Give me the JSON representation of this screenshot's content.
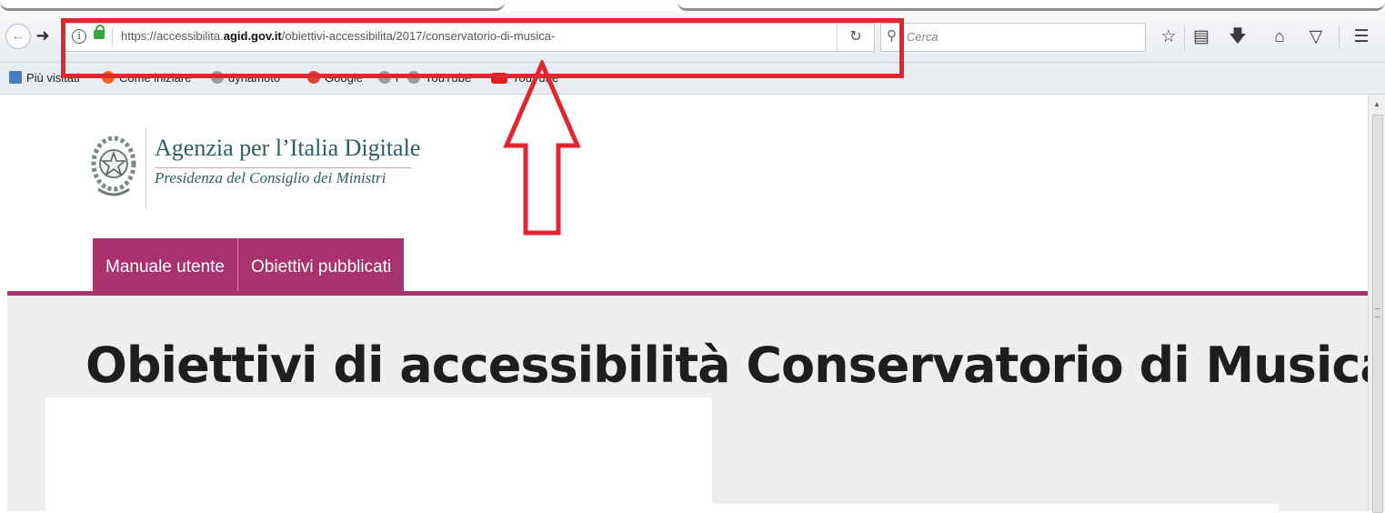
{
  "browser": {
    "url": {
      "prefix": "https://accessibilita.",
      "host": "agid.gov.it",
      "path": "/obiettivi-accessibilita/2017/conservatorio-di-musica-"
    },
    "search_placeholder": "Cerca",
    "bookmarks": [
      {
        "label": "Più visitati",
        "icon": "bookmark-folder-icon"
      },
      {
        "label": "Come iniziare",
        "icon": "firefox-icon"
      },
      {
        "label": "dynamoto",
        "icon": "globe-icon"
      },
      {
        "label": "Google",
        "icon": "google-icon"
      },
      {
        "label": "i",
        "icon": "globe-icon"
      },
      {
        "label": "YouTube",
        "icon": "globe-icon"
      },
      {
        "label": "YouTube",
        "icon": "youtube-icon"
      }
    ],
    "toolbar_icons": [
      "bookmark-star-icon",
      "reading-list-icon",
      "download-icon",
      "home-icon",
      "pocket-icon",
      "menu-icon"
    ]
  },
  "site": {
    "org_name": "Agenzia per l’Italia Digitale",
    "org_subtitle": "Presidenza del Consiglio dei Ministri",
    "menu": [
      "Manuale utente",
      "Obiettivi pubblicati"
    ],
    "page_title": "Obiettivi di accessibilità Conservatorio di Musica"
  },
  "colors": {
    "brand_magenta": "#a7326e",
    "brand_teal": "#2c5e5e",
    "annotation_red": "#e0262f"
  }
}
